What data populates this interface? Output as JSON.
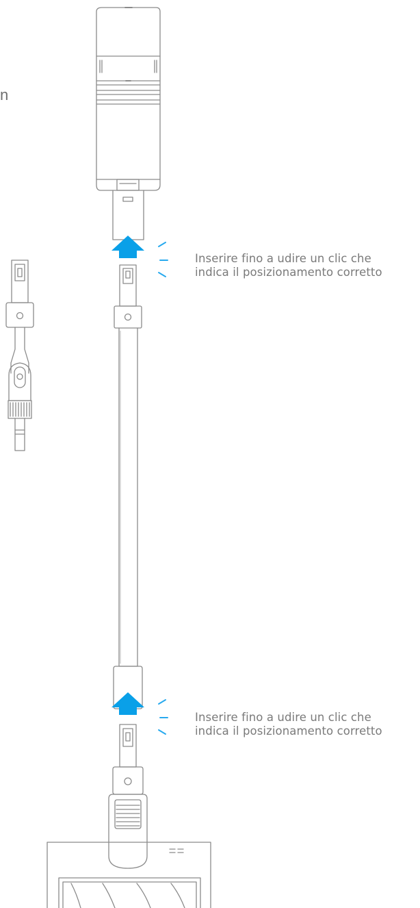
{
  "header": {
    "cutoff_text": "n"
  },
  "steps": [
    {
      "caption_line1": "Inserire fino a udire un clic che",
      "caption_line2": "indica il posizionamento corretto"
    },
    {
      "caption_line1": "Inserire fino a udire un clic che",
      "caption_line2": "indica il posizionamento corretto"
    }
  ],
  "colors": {
    "line": "#8a8a8a",
    "accent_arrow": "#0aa0e8",
    "click_marks": "#27a9ee",
    "caption_text": "#7a7a7a"
  },
  "icons": {
    "insert_arrow": "up-arrow-icon",
    "click_sound": "click-mark-icon"
  }
}
